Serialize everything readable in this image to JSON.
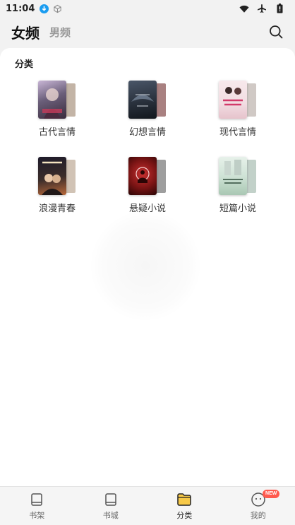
{
  "status_bar": {
    "time": "11:04",
    "icons": [
      "download-icon",
      "cube-icon",
      "wifi-icon",
      "airplane-icon",
      "battery-icon"
    ]
  },
  "header": {
    "active_tab": "女频",
    "inactive_tab": "男频",
    "search_icon": "search-icon"
  },
  "section": {
    "title": "分类"
  },
  "categories": [
    {
      "label": "古代言情",
      "cover_text": "",
      "front": "#6b5f7a",
      "back": "#b9a796"
    },
    {
      "label": "幻想言情",
      "cover_text": "",
      "front": "#2c3440",
      "back": "#9a6b6b"
    },
    {
      "label": "现代言情",
      "cover_text": "",
      "front": "#f2dde2",
      "back": "#c8c0bb"
    },
    {
      "label": "浪漫青春",
      "cover_text": "",
      "front": "#3b2d2a",
      "back": "#c9b8a8"
    },
    {
      "label": "悬疑小说",
      "cover_text": "",
      "front": "#7a1414",
      "back": "#8d8d8d"
    },
    {
      "label": "短篇小说",
      "cover_text": "",
      "front": "#cfe3d6",
      "back": "#b7c9c0"
    }
  ],
  "bottom_nav": [
    {
      "label": "书架",
      "icon": "bookshelf-icon",
      "active": false
    },
    {
      "label": "书城",
      "icon": "book-icon",
      "active": false
    },
    {
      "label": "分类",
      "icon": "folder-icon",
      "active": true
    },
    {
      "label": "我的",
      "icon": "profile-icon",
      "active": false,
      "badge": "NEW"
    }
  ],
  "colors": {
    "accent": "#f7c948",
    "badge": "#ff5a4e",
    "text_primary": "#222222",
    "text_muted": "#999999"
  }
}
